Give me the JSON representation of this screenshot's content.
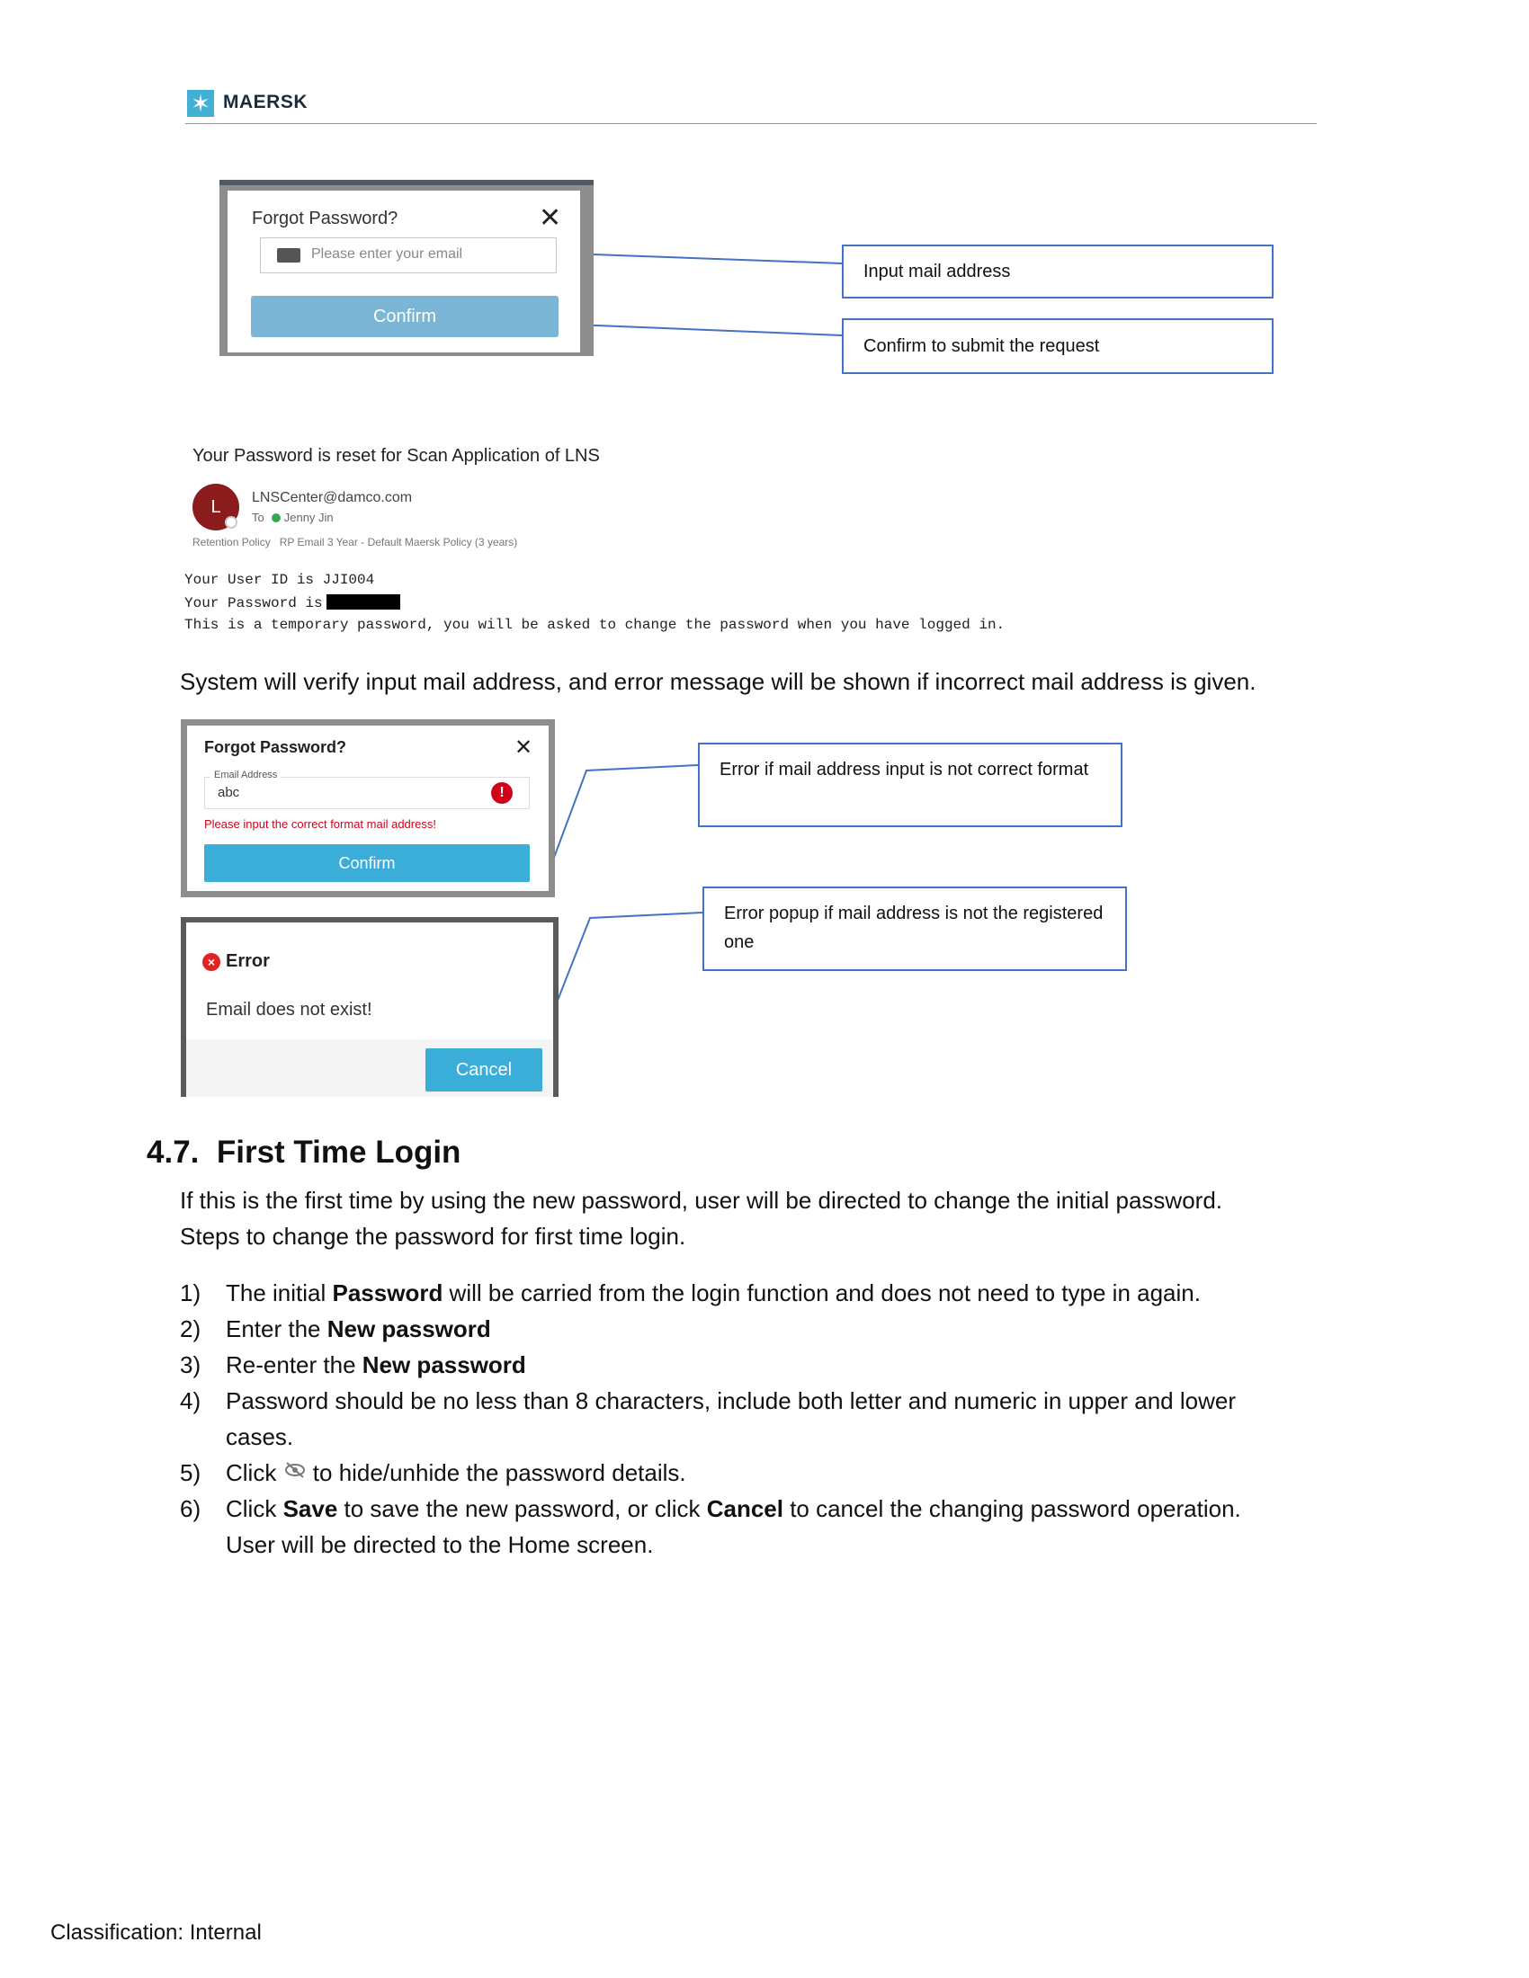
{
  "header": {
    "logo_text": "MAERSK",
    "logo_icon": "maersk-star-icon"
  },
  "forgot_dialog": {
    "title": "Forgot Password?",
    "email_placeholder": "Please enter your email",
    "confirm_label": "Confirm"
  },
  "callouts": {
    "input_mail": "Input mail address",
    "confirm_submit": "Confirm to submit the request",
    "format_error": "Error if mail address input is not correct format",
    "not_registered": "Error popup if mail address is not the registered one"
  },
  "email": {
    "subject": "Your Password is reset for Scan Application of LNS",
    "avatar_letter": "L",
    "sender": "LNSCenter@damco.com",
    "to_label": "To",
    "to_name": "Jenny Jin",
    "retention_label": "Retention Policy",
    "retention_value": "RP Email 3 Year - Default Maersk Policy (3 years)",
    "line_user_id": "Your User ID is JJI004",
    "line_password": "Your Password is",
    "line_temp": "This is a temporary password, you will be asked to change the password when you have logged in."
  },
  "verify_text": "System will verify input mail address, and error message will be shown if incorrect mail address is given.",
  "format_dialog": {
    "title": "Forgot Password?",
    "field_label": "Email Address",
    "field_value": "abc",
    "error_message": "Please input the correct format mail address!",
    "confirm_label": "Confirm"
  },
  "error_popup": {
    "title": "Error",
    "message": "Email does not exist!",
    "cancel_label": "Cancel"
  },
  "section": {
    "number": "4.7.",
    "title": "First Time Login",
    "intro_1": "If this is the first time by using the new password, user will be directed to change the initial password.",
    "intro_2": "Steps to change the password for first time login.",
    "steps": [
      {
        "num": "1)",
        "pre": "The initial ",
        "bold": "Password",
        "post": " will be carried from the login function and does not need to type in again."
      },
      {
        "num": "2)",
        "pre": "Enter the ",
        "bold": "New password",
        "post": ""
      },
      {
        "num": "3)",
        "pre": "Re-enter the ",
        "bold": "New password",
        "post": ""
      },
      {
        "num": "4)",
        "line1": "Password should be no less than 8 characters, include both letter and numeric in upper and lower",
        "line2": "cases."
      },
      {
        "num": "5)",
        "pre": "Click ",
        "post": " to hide/unhide the password details."
      },
      {
        "num": "6)",
        "pre": "Click ",
        "bold1": "Save",
        "mid": " to save the new password, or click ",
        "bold2": "Cancel",
        "post": " to cancel the changing password operation.",
        "line2": "User will be directed to the Home screen."
      }
    ]
  },
  "footer": {
    "classification": "Classification: Internal"
  }
}
